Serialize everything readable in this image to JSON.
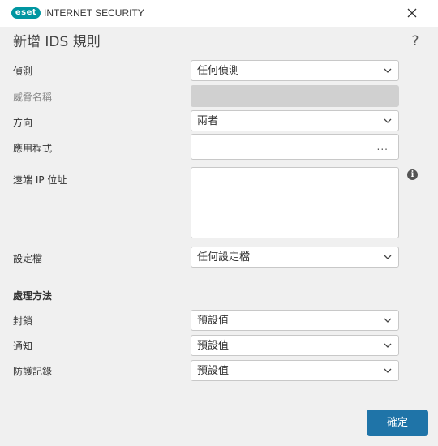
{
  "window": {
    "logo_text": "eset",
    "app_title": "INTERNET SECURITY",
    "close_icon": "close-icon"
  },
  "page": {
    "title": "新增 IDS 規則",
    "help_icon": "?"
  },
  "form": {
    "detection": {
      "label": "偵測",
      "value": "任何偵測"
    },
    "threat_name": {
      "label": "威脅名稱",
      "value": ""
    },
    "direction": {
      "label": "方向",
      "value": "兩者"
    },
    "application": {
      "label": "應用程式",
      "value": "",
      "browse": "..."
    },
    "remote_ip": {
      "label": "遠端 IP 位址",
      "value": "",
      "info": "i"
    },
    "profile": {
      "label": "設定檔",
      "value": "任何設定檔"
    }
  },
  "action": {
    "heading": "處理方法",
    "block": {
      "label": "封鎖",
      "value": "預設值"
    },
    "notify": {
      "label": "通知",
      "value": "預設值"
    },
    "log": {
      "label": "防護記錄",
      "value": "預設值"
    }
  },
  "buttons": {
    "ok": "確定"
  },
  "colors": {
    "brand": "#0096a1",
    "primary_button": "#1f74a8",
    "background": "#f0f0f0"
  }
}
